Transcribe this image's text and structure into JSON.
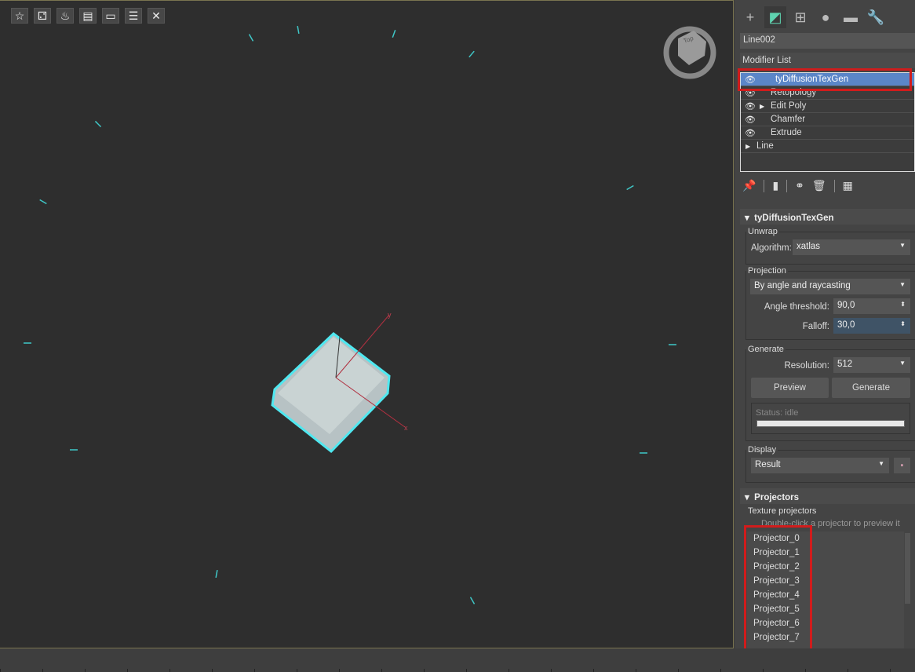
{
  "viewport": {
    "toolbar": [
      "favorite-icon",
      "dice-icon",
      "bake-icon",
      "save-icon",
      "display-icon",
      "settings-sliders-icon",
      "close-icon"
    ],
    "viewcube_label": "Top",
    "axis_x": "x",
    "axis_y": "y",
    "selection_color": "#4fe8f0"
  },
  "panel": {
    "tabs": [
      "create",
      "modify",
      "hierarchy",
      "motion",
      "display",
      "utilities"
    ],
    "object_name": "Line002",
    "modifier_list_label": "Modifier List",
    "stack": [
      {
        "label": "tyDiffusionTexGen",
        "eye": true,
        "expand": false,
        "selected": true
      },
      {
        "label": "Retopology",
        "eye": true,
        "expand": false
      },
      {
        "label": "Edit Poly",
        "eye": true,
        "expand": true
      },
      {
        "label": "Chamfer",
        "eye": true,
        "expand": false
      },
      {
        "label": "Extrude",
        "eye": true,
        "expand": false
      },
      {
        "label": "Line",
        "eye": false,
        "expand": true
      }
    ],
    "rollout_title": "tyDiffusionTexGen",
    "unwrap": {
      "group": "Unwrap",
      "algorithm_label": "Algorithm:",
      "algorithm": "xatlas"
    },
    "projection": {
      "group": "Projection",
      "mode": "By angle and raycasting",
      "angle_label": "Angle threshold:",
      "angle": "90,0",
      "falloff_label": "Falloff:",
      "falloff": "30,0"
    },
    "generate": {
      "group": "Generate",
      "resolution_label": "Resolution:",
      "resolution": "512",
      "preview": "Preview",
      "generate": "Generate",
      "status": "Status: idle",
      "progress": 0
    },
    "display": {
      "group": "Display",
      "value": "Result"
    },
    "projectors": {
      "title": "Projectors",
      "group": "Texture projectors",
      "hint": "Double-click a projector to preview it",
      "items": [
        "Projector_0",
        "Projector_1",
        "Projector_2",
        "Projector_3",
        "Projector_4",
        "Projector_5",
        "Projector_6",
        "Projector_7"
      ]
    },
    "highlight_color": "#d01c1c",
    "selected_color": "#5b86c8"
  }
}
